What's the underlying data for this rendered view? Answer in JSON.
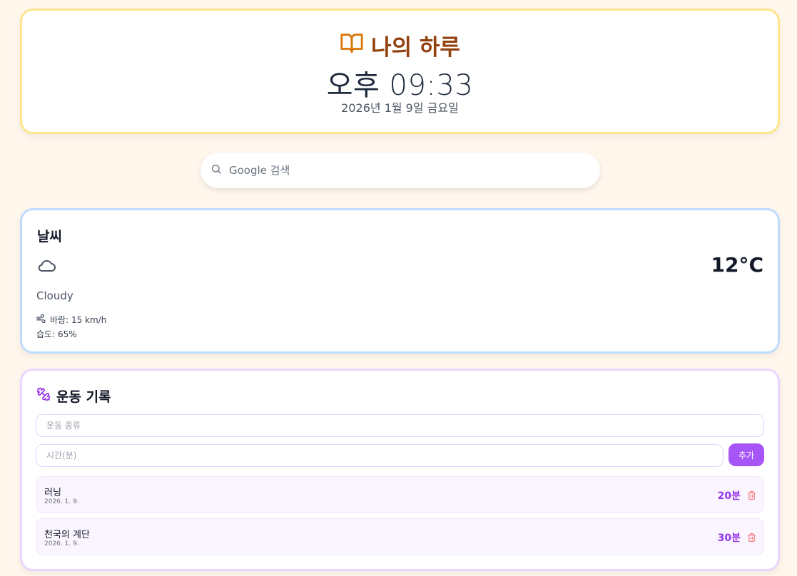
{
  "header": {
    "title": "나의 하루",
    "time": "오후 09:33",
    "date": "2026년 1월 9일 금요일",
    "icon": "book-open-icon"
  },
  "search": {
    "placeholder": "Google 검색",
    "icon": "search-icon"
  },
  "weather": {
    "title": "날씨",
    "icon": "cloud-icon",
    "temperature": "12°C",
    "condition": "Cloudy",
    "wind": "바람: 15 km/h",
    "humidity": "습도: 65%"
  },
  "exercise": {
    "title": "운동 기록",
    "icon": "dumbbell-icon",
    "type_placeholder": "운동 종류",
    "minutes_placeholder": "시간(분)",
    "add_label": "추가",
    "items": [
      {
        "name": "러닝",
        "date": "2026. 1. 9.",
        "duration": "20분"
      },
      {
        "name": "천국의 계단",
        "date": "2026. 1. 9.",
        "duration": "30분"
      }
    ]
  },
  "colors": {
    "background": "#fff7ec",
    "header_border": "#fde68a",
    "weather_border": "#bfdbfe",
    "exercise_border": "#e9d5ff",
    "accent": "#a855f7",
    "title_brown": "#92400e",
    "delete_red": "#f87171"
  }
}
